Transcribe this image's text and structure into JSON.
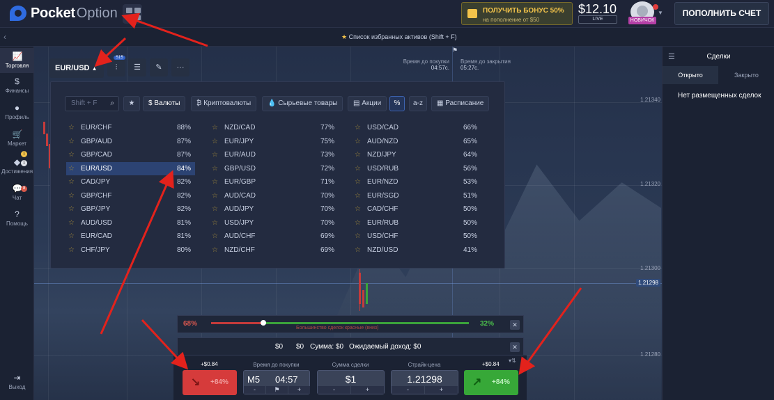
{
  "topbar": {
    "logo_bold": "Pocket",
    "logo_light": "Option",
    "bonus_title": "ПОЛУЧИТЬ БОНУС 50%",
    "bonus_sub": "на пополнение от $50",
    "balance": "$12.10",
    "account_type": "LIVE",
    "user_badge": "НОВИЧОК",
    "deposit_label": "ПОПОЛНИТЬ СЧЕТ"
  },
  "subbar": {
    "favorites_label": "Список избранных активов (Shift + F)"
  },
  "sidebar": {
    "items": [
      {
        "label": "Торговля",
        "icon": "chart-icon"
      },
      {
        "label": "Финансы",
        "icon": "dollar-icon"
      },
      {
        "label": "Профиль",
        "icon": "user-icon"
      },
      {
        "label": "Маркет",
        "icon": "cart-icon"
      },
      {
        "label": "Достижения",
        "icon": "diamond-icon"
      },
      {
        "label": "Чат",
        "icon": "chat-icon"
      },
      {
        "label": "Помощь",
        "icon": "help-icon"
      }
    ],
    "badge_market": "1",
    "badge_ach": "1",
    "badge_chat": "8",
    "exit_label": "Выход"
  },
  "chart": {
    "pair": "EUR/USD",
    "timeframe_badge": "S15",
    "timer_buy_label": "Время до покупки",
    "timer_buy_value": "04:57c.",
    "timer_close_label": "Время до закрытия",
    "timer_close_value": "05:27c.",
    "price_labels": [
      "1.21340",
      "1.21320",
      "1.21300",
      "1.21298",
      "1.21280"
    ]
  },
  "dropdown": {
    "search_placeholder": "Shift + F",
    "categories": [
      "Валюты",
      "Криптовалюты",
      "Сырьевые товары",
      "Акции",
      "%",
      "a-z",
      "Расписание"
    ],
    "col1": [
      {
        "name": "EUR/CHF",
        "pct": "88%"
      },
      {
        "name": "GBP/AUD",
        "pct": "87%"
      },
      {
        "name": "GBP/CAD",
        "pct": "87%"
      },
      {
        "name": "EUR/USD",
        "pct": "84%"
      },
      {
        "name": "CAD/JPY",
        "pct": "82%"
      },
      {
        "name": "GBP/CHF",
        "pct": "82%"
      },
      {
        "name": "GBP/JPY",
        "pct": "82%"
      },
      {
        "name": "AUD/USD",
        "pct": "81%"
      },
      {
        "name": "EUR/CAD",
        "pct": "81%"
      },
      {
        "name": "CHF/JPY",
        "pct": "80%"
      }
    ],
    "col2": [
      {
        "name": "NZD/CAD",
        "pct": "77%"
      },
      {
        "name": "EUR/JPY",
        "pct": "75%"
      },
      {
        "name": "EUR/AUD",
        "pct": "73%"
      },
      {
        "name": "GBP/USD",
        "pct": "72%"
      },
      {
        "name": "EUR/GBP",
        "pct": "71%"
      },
      {
        "name": "AUD/CAD",
        "pct": "70%"
      },
      {
        "name": "AUD/JPY",
        "pct": "70%"
      },
      {
        "name": "USD/JPY",
        "pct": "70%"
      },
      {
        "name": "AUD/CHF",
        "pct": "69%"
      },
      {
        "name": "NZD/CHF",
        "pct": "69%"
      }
    ],
    "col3": [
      {
        "name": "USD/CAD",
        "pct": "66%"
      },
      {
        "name": "AUD/NZD",
        "pct": "65%"
      },
      {
        "name": "NZD/JPY",
        "pct": "64%"
      },
      {
        "name": "USD/RUB",
        "pct": "56%"
      },
      {
        "name": "EUR/NZD",
        "pct": "53%"
      },
      {
        "name": "EUR/SGD",
        "pct": "51%"
      },
      {
        "name": "CAD/CHF",
        "pct": "50%"
      },
      {
        "name": "EUR/RUB",
        "pct": "50%"
      },
      {
        "name": "USD/CHF",
        "pct": "50%"
      },
      {
        "name": "NZD/USD",
        "pct": "41%"
      }
    ]
  },
  "sentiment": {
    "red_pct": "68%",
    "green_pct": "32%",
    "caption": "Большинство сделок красные (вниз)",
    "red_fraction": 0.68
  },
  "sums": {
    "v1": "$0",
    "v2": "$0",
    "sum_label": "Сумма: $0",
    "expected_label": "Ожидаемый доход: $0"
  },
  "trade": {
    "profit_left": "+$0.84",
    "profit_right": "+$0.84",
    "time_label": "Время до покупки",
    "timeframe": "M5",
    "time_value": "04:57",
    "amount_label": "Сумма сделки",
    "amount_value": "$1",
    "strike_label": "Страйк-цена",
    "strike_value": "1.21298",
    "sell_label": "+84%",
    "buy_label": "+84%",
    "minus": "-",
    "plus": "+"
  },
  "right_panel": {
    "title": "Сделки",
    "tab_open": "Открыто",
    "tab_closed": "Закрыто",
    "empty": "Нет размещенных сделок"
  },
  "colors": {
    "sell": "#d63b3b",
    "buy": "#37a838",
    "selected_row": "#2c4373",
    "annotation": "#e3221c"
  }
}
